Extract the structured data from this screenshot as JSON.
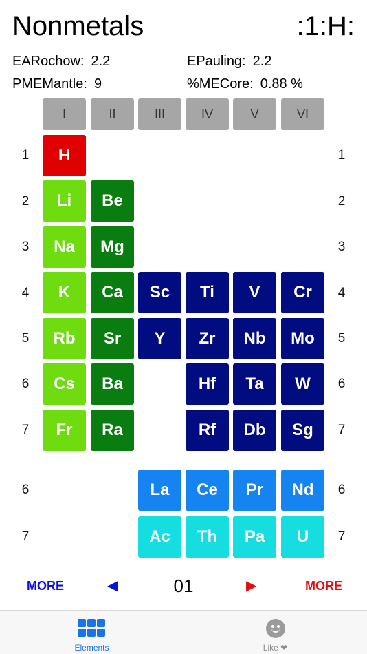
{
  "header": {
    "title": "Nonmetals",
    "symbol": ":1:H:"
  },
  "properties": {
    "earochow_label": "EARochow:",
    "earochow_value": "2.2",
    "epauling_label": "EPauling:",
    "epauling_value": "2.2",
    "pmemantle_label": "PMEMantle:",
    "pmemantle_value": "9",
    "mecore_label": "%MECore:",
    "mecore_value": "0.88 %"
  },
  "groups": [
    "I",
    "II",
    "III",
    "IV",
    "V",
    "VI"
  ],
  "periods_left": [
    "1",
    "2",
    "3",
    "4",
    "5",
    "6",
    "7"
  ],
  "periods_right": [
    "1",
    "2",
    "3",
    "4",
    "5",
    "6",
    "7"
  ],
  "fblock_labels_left": [
    "6",
    "7"
  ],
  "fblock_labels_right": [
    "6",
    "7"
  ],
  "elements": {
    "H": "H",
    "Li": "Li",
    "Be": "Be",
    "Na": "Na",
    "Mg": "Mg",
    "K": "K",
    "Ca": "Ca",
    "Sc": "Sc",
    "Ti": "Ti",
    "V": "V",
    "Cr": "Cr",
    "Rb": "Rb",
    "Sr": "Sr",
    "Y": "Y",
    "Zr": "Zr",
    "Nb": "Nb",
    "Mo": "Mo",
    "Cs": "Cs",
    "Ba": "Ba",
    "Hf": "Hf",
    "Ta": "Ta",
    "W": "W",
    "Fr": "Fr",
    "Ra": "Ra",
    "Rf": "Rf",
    "Db": "Db",
    "Sg": "Sg",
    "La": "La",
    "Ce": "Ce",
    "Pr": "Pr",
    "Nd": "Nd",
    "Ac": "Ac",
    "Th": "Th",
    "Pa": "Pa",
    "U": "U"
  },
  "colors": {
    "selected": "#e00000",
    "alkali": "#6fdc0f",
    "alkaline_earth": "#0a7d10",
    "transition": "#000c80",
    "lanthanide": "#1583f0",
    "actinide": "#16dde0",
    "group_header": "#a6a6a6",
    "nav_left": "#0a10d8",
    "nav_right": "#e01010",
    "tab_active": "#1a73e8",
    "tab_inactive": "#8e8e8e"
  },
  "nav": {
    "more_left": "MORE",
    "more_right": "MORE",
    "prev_icon": "◀",
    "next_icon": "▶",
    "page": "01"
  },
  "tabs": {
    "elements_label": "Elements",
    "like_label": "Like ❤"
  }
}
